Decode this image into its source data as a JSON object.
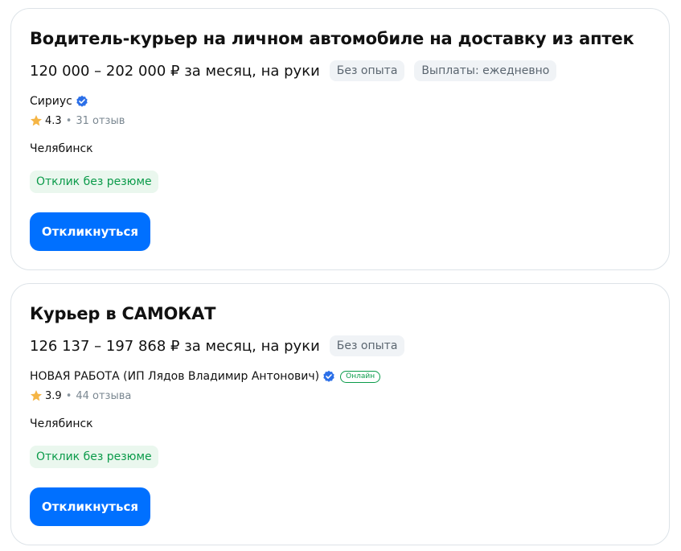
{
  "vacancies": [
    {
      "title": "Водитель-курьер на личном автомобиле на доставку из аптек",
      "salary": "120 000 – 202 000 ₽ за месяц, на руки",
      "tags": [
        "Без опыта",
        "Выплаты: ежедневно"
      ],
      "company": "Сириус",
      "rating": "4.3",
      "reviews": "31 отзыв",
      "city": "Челябинск",
      "resume_tag": "Отклик без резюме",
      "apply_label": "Откликнуться"
    },
    {
      "title": "Курьер в САМОКАТ",
      "salary": "126 137 – 197 868 ₽ за месяц, на руки",
      "tags": [
        "Без опыта"
      ],
      "company": "НОВАЯ РАБОТА (ИП Лядов Владимир Антонович)",
      "online_badge": "Онлайн",
      "rating": "3.9",
      "reviews": "44 отзыва",
      "city": "Челябинск",
      "resume_tag": "Отклик без резюме",
      "apply_label": "Откликнуться"
    }
  ],
  "colors": {
    "accent": "#0070ff",
    "verified": "#2b6fe8",
    "star": "#f5b545",
    "green": "#0b9b4a"
  },
  "icons": {
    "verified": "verified-badge-icon",
    "star": "star-icon"
  }
}
